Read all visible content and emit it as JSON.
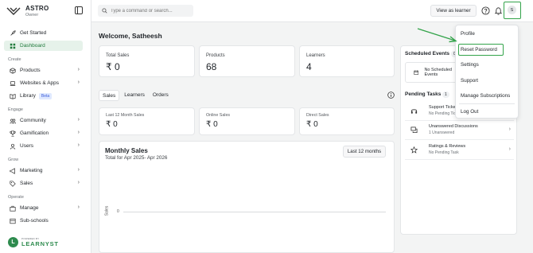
{
  "brand": {
    "name": "ASTRO",
    "role": "Owner"
  },
  "sidebar": {
    "top_items": [
      {
        "label": "Get Started",
        "icon": "rocket-icon"
      },
      {
        "label": "Dashboard",
        "icon": "grid-icon",
        "active": true
      }
    ],
    "sections": [
      {
        "title": "Create",
        "items": [
          {
            "label": "Products",
            "icon": "package-icon",
            "chevron": true
          },
          {
            "label": "Websites & Apps",
            "icon": "laptop-icon",
            "chevron": true
          },
          {
            "label": "Library",
            "icon": "book-icon",
            "badge": "Beta"
          }
        ]
      },
      {
        "title": "Engage",
        "items": [
          {
            "label": "Community",
            "icon": "community-icon",
            "chevron": true
          },
          {
            "label": "Gamification",
            "icon": "trophy-icon",
            "chevron": true
          },
          {
            "label": "Users",
            "icon": "user-icon",
            "chevron": true
          }
        ]
      },
      {
        "title": "Grow",
        "items": [
          {
            "label": "Marketing",
            "icon": "megaphone-icon",
            "chevron": true
          },
          {
            "label": "Sales",
            "icon": "tag-icon",
            "chevron": true
          }
        ]
      },
      {
        "title": "Operate",
        "items": [
          {
            "label": "Manage",
            "icon": "briefcase-icon",
            "chevron": true
          },
          {
            "label": "Sub-schools",
            "icon": "building-icon"
          }
        ]
      }
    ],
    "powered_by": {
      "small": "POWERED BY",
      "name": "LEARNYST",
      "mark": "L"
    }
  },
  "topbar": {
    "search_placeholder": "Type a command or search...",
    "view_as_learner": "View as learner",
    "avatar_initial": "S"
  },
  "main": {
    "welcome": "Welcome, Satheesh",
    "stats": [
      {
        "label": "Total Sales",
        "value": "₹ 0"
      },
      {
        "label": "Products",
        "value": "68"
      },
      {
        "label": "Learners",
        "value": "4"
      }
    ],
    "tabs": [
      "Sales",
      "Learners",
      "Orders"
    ],
    "active_tab": "Sales",
    "sub_stats": [
      {
        "label": "Last 12 Month Sales",
        "value": "₹ 0"
      },
      {
        "label": "Online Sales",
        "value": "₹ 0"
      },
      {
        "label": "Direct Sales",
        "value": "₹ 0"
      }
    ],
    "monthly": {
      "title": "Monthly Sales",
      "subtitle": "Total for Apr 2025- Apr 2026",
      "range": "Last 12 months",
      "ylabel": "Sales",
      "tick": "0"
    }
  },
  "right": {
    "scheduled": {
      "title": "Scheduled Events",
      "count": "0",
      "empty": "No Scheduled Events"
    },
    "pending": {
      "title": "Pending Tasks",
      "count": "1",
      "tasks": [
        {
          "name": "Support Tickets",
          "sub": "No Pending Tickets",
          "icon": "headset-icon"
        },
        {
          "name": "Unanswered Discussions",
          "sub": "1 Unanswered",
          "icon": "chat-icon"
        },
        {
          "name": "Ratings & Reviews",
          "sub": "No Pending Task",
          "icon": "star-icon"
        }
      ]
    }
  },
  "dropdown": {
    "items": [
      "Profile",
      "Reset Password",
      "Settings",
      "Support",
      "Manage Subscriptions",
      "Log Out"
    ]
  },
  "colors": {
    "accent": "#33a34a",
    "active_bg": "#e6f2ea",
    "brand_green": "#2e8b4e"
  }
}
